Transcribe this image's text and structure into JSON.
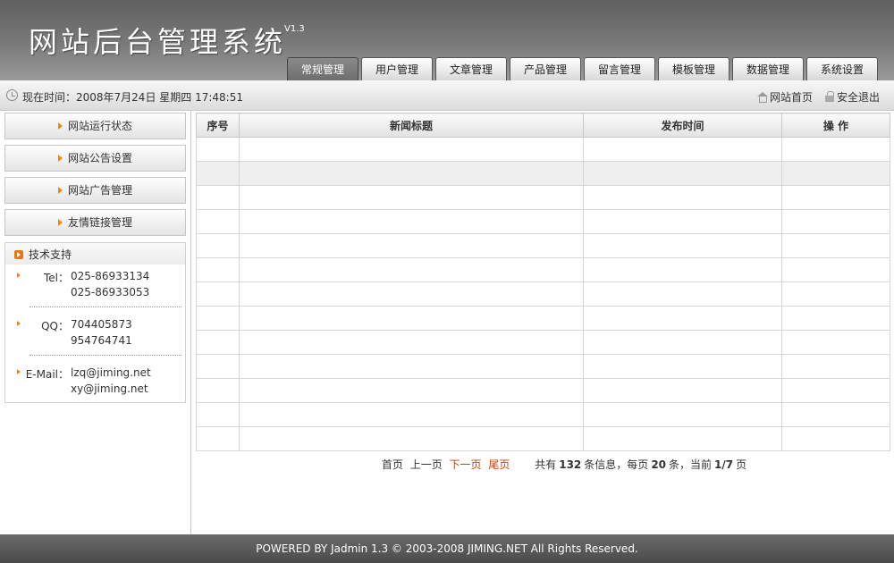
{
  "header": {
    "title": "网站后台管理系统",
    "version": "V1.3",
    "tabs": [
      {
        "label": "常规管理",
        "active": true
      },
      {
        "label": "用户管理"
      },
      {
        "label": "文章管理"
      },
      {
        "label": "产品管理"
      },
      {
        "label": "留言管理"
      },
      {
        "label": "模板管理"
      },
      {
        "label": "数据管理"
      },
      {
        "label": "系统设置"
      }
    ]
  },
  "subbar": {
    "time_label": "现在时间：2008年7月24日 星期四 17:48:51",
    "home_label": "网站首页",
    "logout_label": "安全退出"
  },
  "sidebar": {
    "menu": [
      "网站运行状态",
      "网站公告设置",
      "网站广告管理",
      "友情链接管理"
    ],
    "support": {
      "title": "技术支持",
      "tel_label": "Tel：",
      "tel": [
        "025-86933134",
        "025-86933053"
      ],
      "qq_label": "QQ：",
      "qq": [
        "704405873",
        "954764741"
      ],
      "email_label": "E-Mail：",
      "email": [
        "lzq@jiming.net",
        "xy@jiming.net"
      ]
    }
  },
  "table": {
    "columns": [
      "序号",
      "新闻标题",
      "发布时间",
      "操 作"
    ],
    "row_count": 13
  },
  "pager": {
    "first": "首页",
    "prev": "上一页",
    "next": "下一页",
    "last": "尾页",
    "total_prefix": "共有",
    "total": "132",
    "total_suffix": "条信息，每页",
    "per_page": "20",
    "per_page_suffix": "条，当前",
    "current": "1/7",
    "page_suffix": "页"
  },
  "footer": {
    "text": "POWERED BY Jadmin 1.3 © 2003-2008 JIMING.NET All Rights Reserved."
  },
  "colors": {
    "accent_orange": "#e58a1a",
    "pager_link_red": "#c0440c"
  }
}
